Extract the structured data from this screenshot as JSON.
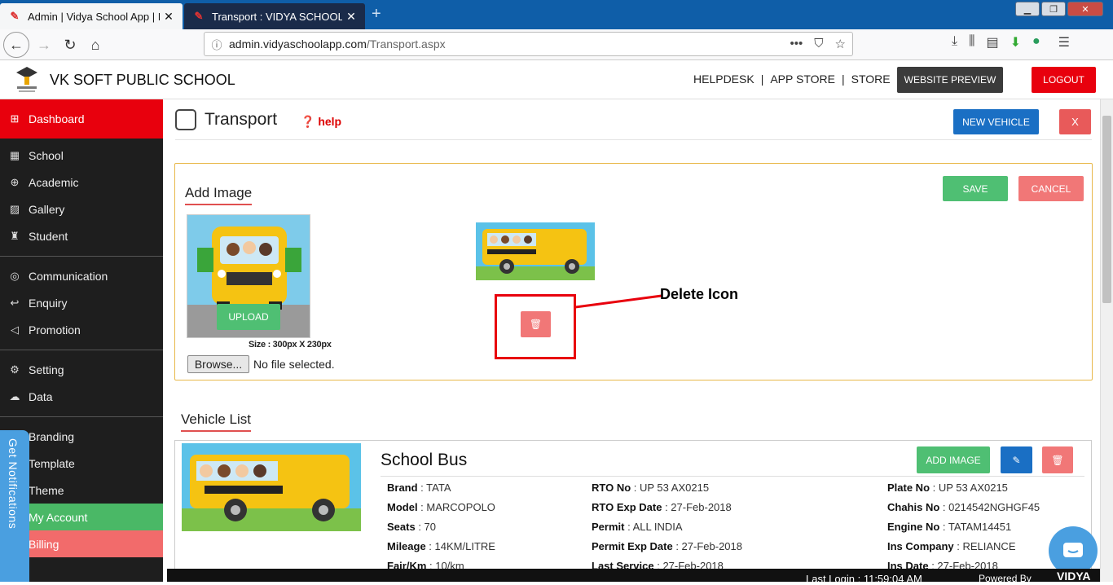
{
  "browser": {
    "tabs": [
      {
        "title": "Admin | Vidya School App | It's",
        "active": true
      },
      {
        "title": "Transport : VIDYA SCHOOL APP",
        "active": false
      }
    ],
    "url_domain": "admin.vidyaschoolapp.com",
    "url_path": "/Transport.aspx"
  },
  "header": {
    "school_name": "VK SOFT PUBLIC SCHOOL",
    "nav": [
      "HELPDESK",
      "|",
      "APP STORE",
      "|",
      "STORE"
    ],
    "website_preview": "WEBSITE PREVIEW",
    "logout": "LOGOUT"
  },
  "sidebar": {
    "items": [
      {
        "label": "Dashboard",
        "icon": "dashboard-icon"
      },
      {
        "label": "School",
        "icon": "school-icon"
      },
      {
        "label": "Academic",
        "icon": "globe-icon"
      },
      {
        "label": "Gallery",
        "icon": "image-icon"
      },
      {
        "label": "Student",
        "icon": "student-icon"
      },
      {
        "label": "Communication",
        "icon": "chat-icon"
      },
      {
        "label": "Enquiry",
        "icon": "reply-icon"
      },
      {
        "label": "Promotion",
        "icon": "megaphone-icon"
      },
      {
        "label": "Setting",
        "icon": "gear-icon"
      },
      {
        "label": "Data",
        "icon": "cloud-icon"
      },
      {
        "label": "Branding",
        "icon": "brush-icon"
      },
      {
        "label": "Template",
        "icon": "template-icon"
      },
      {
        "label": "Theme",
        "icon": "theme-icon"
      },
      {
        "label": "My Account",
        "icon": "user-icon"
      },
      {
        "label": "Billing",
        "icon": "billing-icon"
      }
    ],
    "notifications": "Get Notifications"
  },
  "page": {
    "title": "Transport",
    "help": "help",
    "new_vehicle": "NEW VEHICLE",
    "close": "X"
  },
  "add_image": {
    "title": "Add Image",
    "save": "SAVE",
    "cancel": "CANCEL",
    "upload": "UPLOAD",
    "size_label": "Size : 300px X 230px",
    "browse": "Browse...",
    "no_file": "No file selected.",
    "annotation": "Delete Icon"
  },
  "vehicle_list": {
    "title": "Vehicle List",
    "add_image": "ADD IMAGE",
    "vehicle": {
      "name": "School Bus",
      "col1": [
        {
          "label": "Brand",
          "value": "TATA"
        },
        {
          "label": "Model",
          "value": "MARCOPOLO"
        },
        {
          "label": "Seats",
          "value": "70"
        },
        {
          "label": "Mileage",
          "value": "14KM/LITRE"
        },
        {
          "label": "Fair/Km",
          "value": "10/km"
        }
      ],
      "col2": [
        {
          "label": "RTO No",
          "value": "UP 53 AX0215"
        },
        {
          "label": "RTO Exp Date",
          "value": "27-Feb-2018"
        },
        {
          "label": "Permit",
          "value": "ALL INDIA"
        },
        {
          "label": "Permit Exp Date",
          "value": "27-Feb-2018"
        },
        {
          "label": "Last Service",
          "value": "27-Feb-2018"
        }
      ],
      "col3": [
        {
          "label": "Plate No",
          "value": "UP 53 AX0215"
        },
        {
          "label": "Chahis No",
          "value": "0214542NGHGF45"
        },
        {
          "label": "Engine No",
          "value": "TATAM14451"
        },
        {
          "label": "Ins Company",
          "value": "RELIANCE"
        },
        {
          "label": "Ins Date",
          "value": "27-Feb-2018"
        }
      ]
    }
  },
  "footer": {
    "last_login": "Last Login : 11:59:04 AM",
    "powered_by": "Powered By",
    "brand": "VIDYA"
  },
  "colors": {
    "primary_red": "#e8000d",
    "green": "#4fbf73",
    "blue": "#1a6fc4",
    "light_red": "#f17777"
  }
}
